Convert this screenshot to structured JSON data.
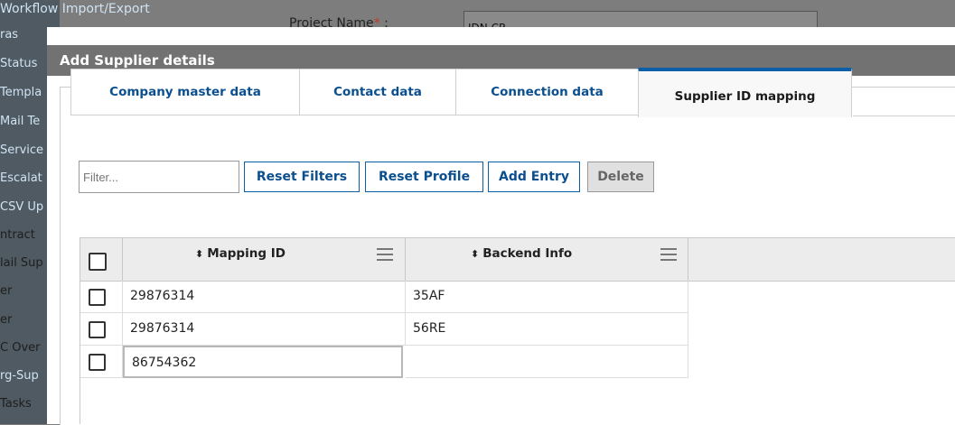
{
  "background": {
    "top_link": "Workflow Import/Export",
    "sidebar_items": [
      "ras",
      "Status",
      "Templa",
      "Mail Te",
      "Service",
      "Escalat",
      "CSV Up",
      "ntract",
      "lail Sup",
      "er",
      "er",
      "C Over",
      "rg-Sup",
      "Tasks"
    ],
    "project_label": "Project Name",
    "project_required": "*",
    "project_colon": ":",
    "project_value": "IDN CR"
  },
  "modal": {
    "title": "Add Supplier details",
    "tabs": [
      {
        "label": "Company master data",
        "active": false
      },
      {
        "label": "Contact data",
        "active": false
      },
      {
        "label": "Connection data",
        "active": false
      },
      {
        "label": "Supplier ID mapping",
        "active": true
      }
    ],
    "toolbar": {
      "filter_placeholder": "Filter...",
      "reset_filters": "Reset Filters",
      "reset_profile": "Reset Profile",
      "add_entry": "Add Entry",
      "delete": "Delete"
    },
    "grid": {
      "columns": [
        "Mapping ID",
        "Backend Info"
      ],
      "rows": [
        {
          "mapping_id": "29876314",
          "backend_info": "35AF"
        },
        {
          "mapping_id": "29876314",
          "backend_info": "56RE"
        },
        {
          "mapping_id": "86754362",
          "backend_info": ""
        }
      ]
    }
  },
  "colors": {
    "accent": "#0b5fa8",
    "link": "#0b4f8f",
    "header_bar": "#727272",
    "overlay": "#7d7d7d"
  }
}
